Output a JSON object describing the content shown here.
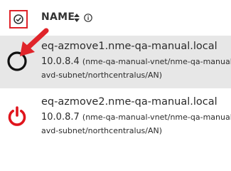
{
  "header": {
    "column_title": "NAME"
  },
  "rows": [
    {
      "name": "eq-azmove1.nme-qa-manual.local",
      "ip": "10.0.8.4",
      "network_line1": "(nme-qa-manual-vnet/nme-qa-manual-",
      "network_line2": "avd-subnet/northcentralus/AN)",
      "status_icon": "circle-icon"
    },
    {
      "name": "eq-azmove2.nme-qa-manual.local",
      "ip": "10.0.8.7",
      "network_line1": "(nme-qa-manual-vnet/nme-qa-manual-",
      "network_line2": "avd-subnet/northcentralus/AN)",
      "status_icon": "power-icon"
    }
  ],
  "colors": {
    "highlight": "#e0242a",
    "power": "#e0141c",
    "row_selected_bg": "#e7e7e7"
  }
}
